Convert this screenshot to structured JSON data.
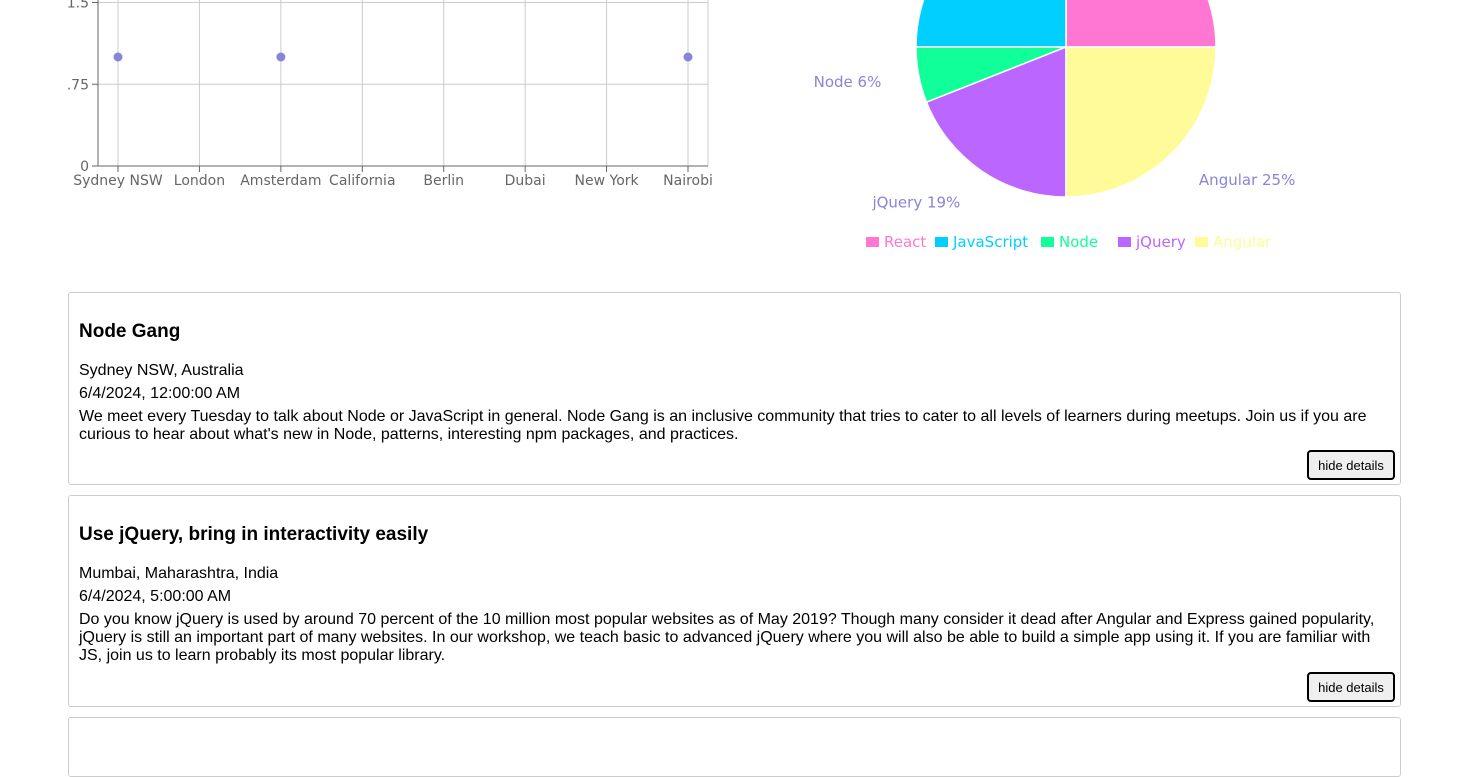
{
  "chart_data": [
    {
      "type": "scatter",
      "categories": [
        "Sydney NSW",
        "London",
        "Amsterdam",
        "California",
        "Berlin",
        "Dubai",
        "New York",
        "Nairobi"
      ],
      "points": [
        {
          "x": "Sydney NSW",
          "y": 1
        },
        {
          "x": "Amsterdam",
          "y": 1
        },
        {
          "x": "Nairobi",
          "y": 1
        }
      ],
      "y_ticks": [
        "0",
        ".75",
        "1.5"
      ],
      "ylim": [
        0,
        1.5
      ],
      "grid": true,
      "color": "#8884d8"
    },
    {
      "type": "pie",
      "slices": [
        {
          "name": "React",
          "value": 25,
          "color": "#ff77d2",
          "label": ""
        },
        {
          "name": "JavaScript",
          "value": 25,
          "color": "#00cfff",
          "label": ""
        },
        {
          "name": "Node",
          "value": 6,
          "color": "#11ff99",
          "label": "Node 6%"
        },
        {
          "name": "jQuery",
          "value": 19,
          "color": "#bb66ff",
          "label": "jQuery 19%"
        },
        {
          "name": "Angular",
          "value": 25,
          "color": "#fffb99",
          "label": "Angular 25%"
        }
      ],
      "legend": [
        "React",
        "JavaScript",
        "Node",
        "jQuery",
        "Angular"
      ],
      "legend_position": "bottom"
    }
  ],
  "events": [
    {
      "title": "Node Gang",
      "location": "Sydney NSW, Australia",
      "date": "6/4/2024, 12:00:00 AM",
      "description": "We meet every Tuesday to talk about Node or JavaScript in general. Node Gang is an inclusive community that tries to cater to all levels of learners during meetups. Join us if you are curious to hear about what's new in Node, patterns, interesting npm packages, and practices.",
      "button_label": "hide details"
    },
    {
      "title": "Use jQuery, bring in interactivity easily",
      "location": "Mumbai, Maharashtra, India",
      "date": "6/4/2024, 5:00:00 AM",
      "description": "Do you know jQuery is used by around 70 percent of the 10 million most popular websites as of May 2019? Though many consider it dead after Angular and Express gained popularity, jQuery is still an important part of many websites. In our workshop, we teach basic to advanced jQuery where you will also be able to build a simple app using it. If you are familiar with JS, join us to learn probably its most popular library.",
      "button_label": "hide details"
    }
  ]
}
